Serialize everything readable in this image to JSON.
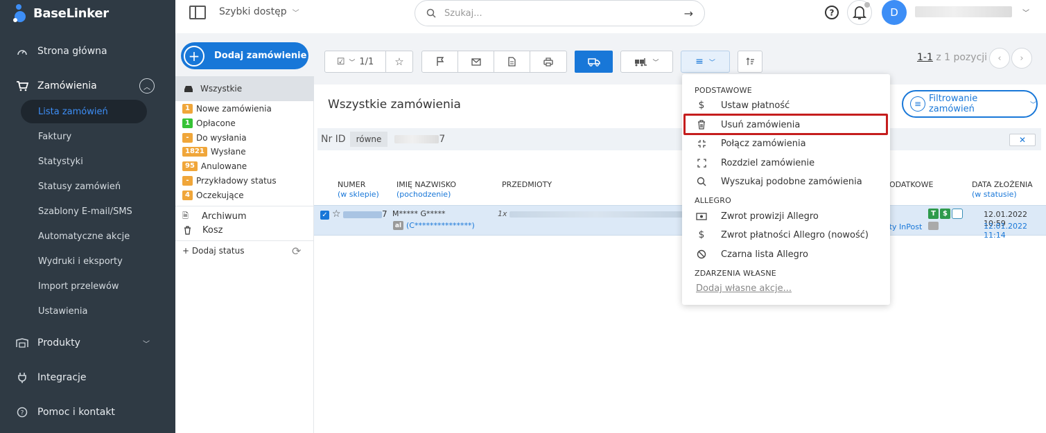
{
  "app": {
    "name": "BaseLinker"
  },
  "sidebar": {
    "main": [
      {
        "label": "Strona główna",
        "icon": "dashboard-icon"
      },
      {
        "label": "Zamówienia",
        "icon": "cart-icon"
      },
      {
        "label": "Produkty",
        "icon": "warehouse-icon"
      },
      {
        "label": "Integracje",
        "icon": "plug-icon"
      },
      {
        "label": "Pomoc i kontakt",
        "icon": "help-icon"
      }
    ],
    "orders_sub": [
      "Lista zamówień",
      "Faktury",
      "Statystyki",
      "Statusy zamówień",
      "Szablony E-mail/SMS",
      "Automatyczne akcje",
      "Wydruki i eksporty",
      "Import przelewów",
      "Ustawienia"
    ]
  },
  "header": {
    "quick_access": "Szybki dostęp",
    "search_placeholder": "Szukaj...",
    "avatar_letter": "D"
  },
  "toolbar": {
    "add_order": "Dodaj zamówienie",
    "selection_count": "1/1",
    "pager_range": "1-1",
    "pager_total": "z 1 pozycji"
  },
  "statuses": {
    "all": "Wszystkie",
    "items": [
      {
        "badge": "1",
        "label": "Nowe zamówienia",
        "color": "#f0a63a"
      },
      {
        "badge": "1",
        "label": "Opłacone",
        "color": "#36c236"
      },
      {
        "badge": "-",
        "label": "Do wysłania",
        "color": "#f0a63a"
      },
      {
        "badge": "1821",
        "label": "Wysłane",
        "color": "#f0a63a"
      },
      {
        "badge": "95",
        "label": "Anulowane",
        "color": "#f0a63a"
      },
      {
        "badge": "-",
        "label": "Przykładowy status",
        "color": "#f0a63a"
      },
      {
        "badge": "4",
        "label": "Oczekujące",
        "color": "#f0a63a"
      }
    ],
    "archive": "Archiwum",
    "trash": "Kosz",
    "add_status": "+ Dodaj status"
  },
  "main": {
    "title": "Wszystkie zamówienia",
    "filter_button": "Filtrowanie zamówień",
    "filter": {
      "field": "Nr ID",
      "operator": "równe",
      "value_suffix": "7"
    },
    "columns": {
      "number": "NUMER",
      "number_sub": "(w sklepie)",
      "name": "IMIĘ NAZWISKO",
      "name_sub": "(pochodzenie)",
      "items": "PRZEDMIOTY",
      "extra": "ODATKOWE",
      "date": "DATA ZŁOŻENIA",
      "date_sub": "(w statusie)"
    },
    "row": {
      "number_suffix": "7",
      "name": "M***** G*****",
      "origin_badge": "al",
      "origin": "(C***************)",
      "items_prefix": "1x",
      "delivery": "aty InPost",
      "date1": "12.01.2022 10:59",
      "date2": "12.01.2022 11:14"
    }
  },
  "dropdown": {
    "sections": [
      {
        "title": "PODSTAWOWE",
        "items": [
          {
            "label": "Ustaw płatność",
            "icon": "dollar-icon"
          },
          {
            "label": "Usuń zamówienia",
            "icon": "trash-icon"
          },
          {
            "label": "Połącz zamówienia",
            "icon": "merge-icon"
          },
          {
            "label": "Rozdziel zamówienie",
            "icon": "split-icon"
          },
          {
            "label": "Wyszukaj podobne zamówienia",
            "icon": "search-icon"
          }
        ]
      },
      {
        "title": "ALLEGRO",
        "items": [
          {
            "label": "Zwrot prowizji Allegro",
            "icon": "money-icon"
          },
          {
            "label": "Zwrot płatności Allegro (nowość)",
            "icon": "dollar-icon"
          },
          {
            "label": "Czarna lista Allegro",
            "icon": "ban-icon"
          }
        ]
      },
      {
        "title": "ZDARZENIA WŁASNE",
        "link": "Dodaj własne akcje..."
      }
    ]
  },
  "colors": {
    "sidebar": "#2f3a44",
    "accent": "#1877d8",
    "highlight": "#c51d1d"
  }
}
